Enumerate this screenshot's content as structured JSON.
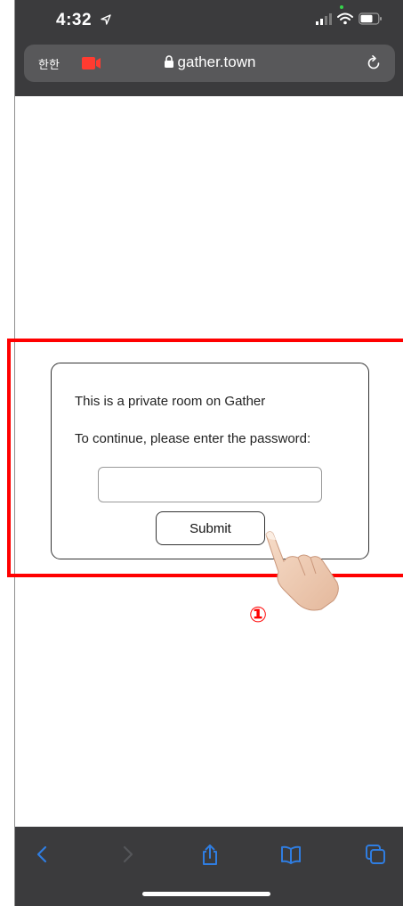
{
  "status_bar": {
    "time": "4:32"
  },
  "browser": {
    "aa_label": "한한",
    "url": "gather.town"
  },
  "dialog": {
    "line1": "This is a private room on Gather",
    "line2": "To continue, please enter the password:",
    "password_value": "",
    "submit_label": "Submit"
  },
  "annotation": {
    "step_number": "①"
  },
  "colors": {
    "chrome": "#3b3b3d",
    "address_bar": "#58585a",
    "highlight": "#ff0000",
    "toolbar_icon": "#2f7de1",
    "camera": "#ff3b30"
  },
  "icons": {
    "status": [
      "location-arrow-icon",
      "signal-icon",
      "wifi-icon",
      "battery-icon"
    ],
    "address": [
      "camera-recording-icon",
      "lock-icon",
      "reload-icon"
    ],
    "toolbar": [
      "back-icon",
      "forward-icon",
      "share-icon",
      "bookmarks-icon",
      "tabs-icon"
    ]
  }
}
